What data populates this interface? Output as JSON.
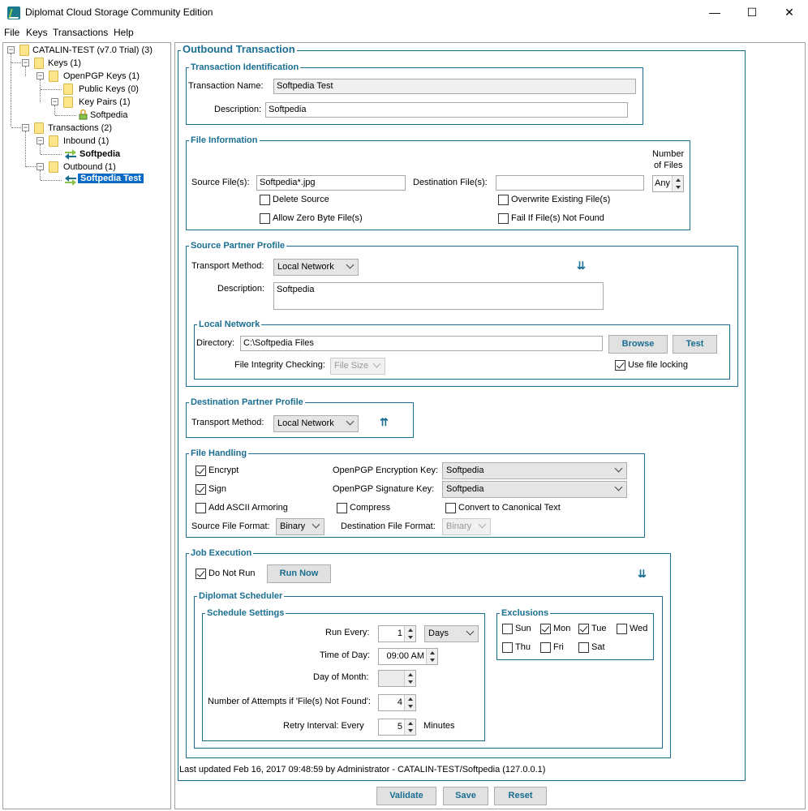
{
  "window": {
    "title": "Diplomat Cloud Storage Community Edition",
    "minimize": "—",
    "maximize": "☐",
    "close": "✕"
  },
  "menu": [
    "File",
    "Keys",
    "Transactions",
    "Help"
  ],
  "tree": {
    "root": "CATALIN-TEST (v7.0 Trial) (3)",
    "keys": "Keys (1)",
    "openpgp_keys": "OpenPGP Keys (1)",
    "public_keys": "Public Keys (0)",
    "key_pairs": "Key Pairs (1)",
    "key_softpedia": "Softpedia",
    "transactions": "Transactions (2)",
    "inbound": "Inbound (1)",
    "inbound_softpedia": "Softpedia",
    "outbound": "Outbound (1)",
    "outbound_softpedia_test": "Softpedia Test"
  },
  "outbound": {
    "title": "Outbound Transaction",
    "identification": {
      "title": "Transaction Identification",
      "name_label": "Transaction Name:",
      "name_value": "Softpedia Test",
      "desc_label": "Description:",
      "desc_value": "Softpedia"
    },
    "file_info": {
      "title": "File Information",
      "source_label": "Source File(s):",
      "source_value": "Softpedia*.jpg",
      "dest_label": "Destination File(s):",
      "dest_value": "",
      "number_label_1": "Number",
      "number_label_2": "of Files",
      "number_value": "Any",
      "delete_source": "Delete Source",
      "allow_zero": "Allow Zero Byte File(s)",
      "overwrite": "Overwrite Existing File(s)",
      "fail_if": "Fail If File(s) Not Found"
    },
    "source_partner": {
      "title": "Source Partner Profile",
      "transport_label": "Transport Method:",
      "transport_value": "Local Network",
      "desc_label": "Description:",
      "desc_value": "Softpedia",
      "local_network": {
        "title": "Local Network",
        "dir_label": "Directory:",
        "dir_value": "C:\\Softpedia Files",
        "browse": "Browse",
        "test": "Test",
        "integrity_label": "File Integrity Checking:",
        "integrity_value": "File Size",
        "use_locking": "Use file locking"
      }
    },
    "dest_partner": {
      "title": "Destination Partner Profile",
      "transport_label": "Transport Method:",
      "transport_value": "Local Network"
    },
    "file_handling": {
      "title": "File Handling",
      "encrypt": "Encrypt",
      "sign": "Sign",
      "ascii": "Add ASCII Armoring",
      "compress": "Compress",
      "canonical": "Convert to Canonical Text",
      "enc_key_label": "OpenPGP Encryption Key:",
      "enc_key_value": "Softpedia",
      "sig_key_label": "OpenPGP Signature Key:",
      "sig_key_value": "Softpedia",
      "src_format_label": "Source File Format:",
      "src_format_value": "Binary",
      "dst_format_label": "Destination File Format:",
      "dst_format_value": "Binary"
    },
    "job": {
      "title": "Job Execution",
      "do_not_run": "Do Not Run",
      "run_now": "Run Now",
      "scheduler": {
        "title": "Diplomat Scheduler",
        "settings_title": "Schedule Settings",
        "run_every_label": "Run Every:",
        "run_every_value": "1",
        "run_every_unit": "Days",
        "time_label": "Time of Day:",
        "time_value": "09:00 AM",
        "dom_label": "Day of Month:",
        "attempts_label": "Number of Attempts if 'File(s) Not Found':",
        "attempts_value": "4",
        "retry_label": "Retry Interval: Every",
        "retry_value": "5",
        "retry_unit": "Minutes",
        "exclusions_title": "Exclusions",
        "days": {
          "sun": "Sun",
          "mon": "Mon",
          "tue": "Tue",
          "wed": "Wed",
          "thu": "Thu",
          "fri": "Fri",
          "sat": "Sat"
        }
      }
    },
    "last_updated": "Last updated Feb 16, 2017 09:48:59 by Administrator - CATALIN-TEST/Softpedia (127.0.0.1)",
    "buttons": {
      "validate": "Validate",
      "save": "Save",
      "reset": "Reset"
    }
  },
  "colors": {
    "accent": "#1a6e91",
    "selection": "#0b6bc4"
  }
}
